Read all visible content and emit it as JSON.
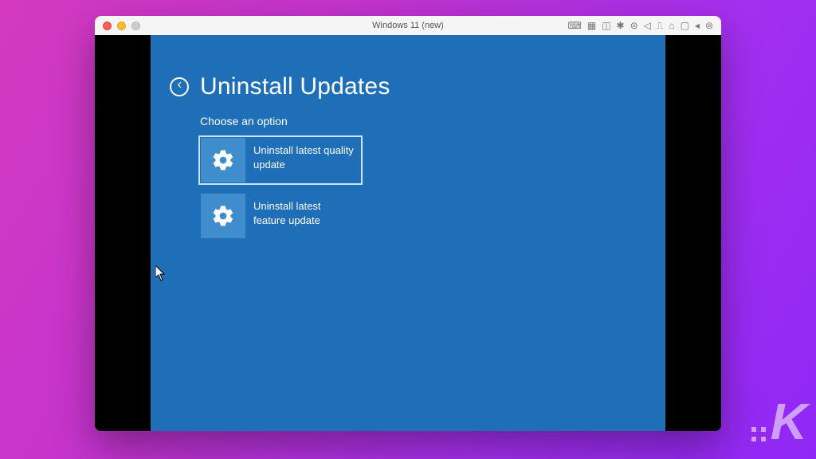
{
  "window": {
    "title": "Windows 11 (new)"
  },
  "winre": {
    "title": "Uninstall Updates",
    "subtitle": "Choose an option",
    "options": [
      {
        "label": "Uninstall latest quality update"
      },
      {
        "label": "Uninstall latest feature update"
      }
    ]
  },
  "watermark": {
    "letter": "K"
  }
}
